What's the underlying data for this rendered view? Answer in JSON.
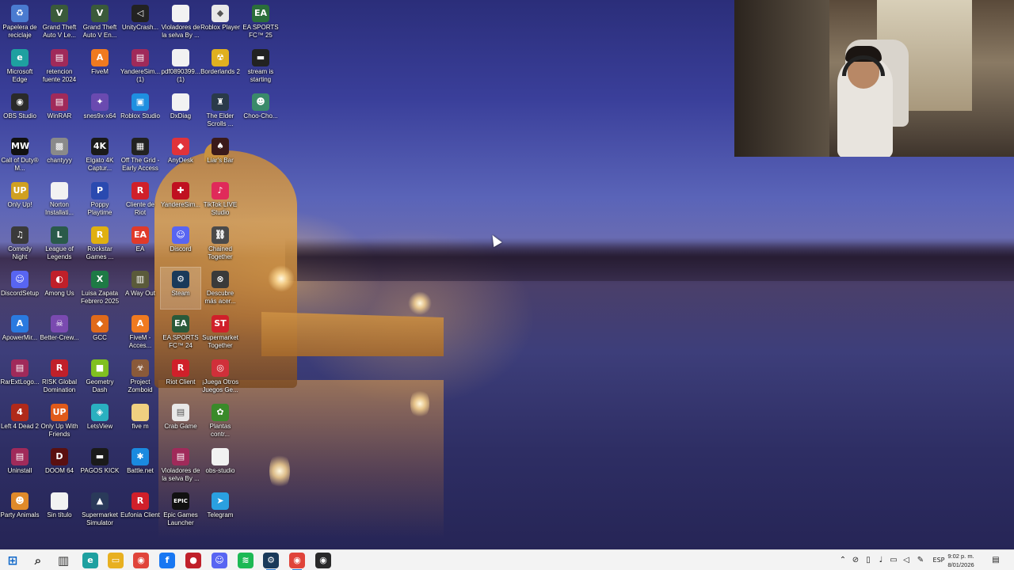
{
  "desktop": {
    "icons": [
      {
        "id": "i0",
        "label": "Papelera de reciclaje",
        "icon": "recycle-bin-icon",
        "color": "#4a7bd0",
        "glyph": "♻"
      },
      {
        "id": "i1",
        "label": "Grand Theft Auto V Le...",
        "icon": "gta-v-icon",
        "color": "#3a5a3a",
        "glyph": "V"
      },
      {
        "id": "i2",
        "label": "Grand Theft Auto V En...",
        "icon": "gta-v-icon",
        "color": "#3a5a3a",
        "glyph": "V"
      },
      {
        "id": "i3",
        "label": "UnityCrash...",
        "icon": "unity-icon",
        "color": "#222222",
        "glyph": "◁"
      },
      {
        "id": "i4",
        "label": "Violadores de la selva By ...",
        "icon": "file-icon",
        "color": "#f2f2f2",
        "glyph": ""
      },
      {
        "id": "i5",
        "label": "Roblox Player",
        "icon": "roblox-icon",
        "color": "#e8e8e8",
        "glyph": "◆"
      },
      {
        "id": "i6",
        "label": "EA SPORTS FC™ 25",
        "icon": "ea-fc-icon",
        "color": "#2b6e3a",
        "glyph": "EA"
      },
      {
        "id": "i7",
        "label": "Microsoft Edge",
        "icon": "edge-icon",
        "color": "#1ea0a0",
        "glyph": "e"
      },
      {
        "id": "i8",
        "label": "retencion fuente 2024",
        "icon": "winrar-archive-icon",
        "color": "#a02a5a",
        "glyph": "▤"
      },
      {
        "id": "i9",
        "label": "FiveM",
        "icon": "fivem-icon",
        "color": "#f07a20",
        "glyph": "A"
      },
      {
        "id": "i10",
        "label": "YandereSim... (1)",
        "icon": "winrar-archive-icon",
        "color": "#a02a5a",
        "glyph": "▤"
      },
      {
        "id": "i11",
        "label": "pdf0890399... (1)",
        "icon": "file-icon",
        "color": "#f2f2f2",
        "glyph": ""
      },
      {
        "id": "i12",
        "label": "Borderlands 2",
        "icon": "borderlands-icon",
        "color": "#e0b020",
        "glyph": "☢"
      },
      {
        "id": "i13",
        "label": "stream is starting",
        "icon": "image-file-icon",
        "color": "#222222",
        "glyph": "▬"
      },
      {
        "id": "i14",
        "label": "OBS Studio",
        "icon": "obs-icon",
        "color": "#2a2a2a",
        "glyph": "◉"
      },
      {
        "id": "i15",
        "label": "WinRAR",
        "icon": "winrar-icon",
        "color": "#a02a5a",
        "glyph": "▤"
      },
      {
        "id": "i16",
        "label": "snes9x-x64",
        "icon": "snes-icon",
        "color": "#6a4ab0",
        "glyph": "✦"
      },
      {
        "id": "i17",
        "label": "Roblox Studio",
        "icon": "roblox-studio-icon",
        "color": "#1e8fe0",
        "glyph": "▣"
      },
      {
        "id": "i18",
        "label": "DxDiag",
        "icon": "file-icon",
        "color": "#f2f2f2",
        "glyph": ""
      },
      {
        "id": "i19",
        "label": "The Elder Scrolls ...",
        "icon": "elder-scrolls-icon",
        "color": "#2a3a4a",
        "glyph": "♜"
      },
      {
        "id": "i20",
        "label": "Choo-Cho...",
        "icon": "choo-choo-icon",
        "color": "#3a8a6a",
        "glyph": "☻"
      },
      {
        "id": "i21",
        "label": "Call of Duty® M...",
        "icon": "call-of-duty-icon",
        "color": "#111111",
        "glyph": "MW"
      },
      {
        "id": "i22",
        "label": "chantyyy",
        "icon": "image-file-icon",
        "color": "#8a8a8a",
        "glyph": "▩"
      },
      {
        "id": "i23",
        "label": "Elgato 4K Captur...",
        "icon": "elgato-icon",
        "color": "#1a1a1a",
        "glyph": "4K"
      },
      {
        "id": "i24",
        "label": "Off The Grid - Early Access",
        "icon": "off-the-grid-icon",
        "color": "#222222",
        "glyph": "▦"
      },
      {
        "id": "i25",
        "label": "AnyDesk",
        "icon": "anydesk-icon",
        "color": "#e0333a",
        "glyph": "◆"
      },
      {
        "id": "i26",
        "label": "Liar's Bar",
        "icon": "liars-bar-icon",
        "color": "#3a1a1a",
        "glyph": "♠"
      },
      {
        "id": "i27",
        "label": "Only Up!",
        "icon": "only-up-icon",
        "color": "#d0a020",
        "glyph": "UP"
      },
      {
        "id": "i28",
        "label": "Norton Installati...",
        "icon": "file-icon",
        "color": "#f2f2f2",
        "glyph": ""
      },
      {
        "id": "i29",
        "label": "Poppy Playtime",
        "icon": "poppy-playtime-icon",
        "color": "#2a4ab0",
        "glyph": "P"
      },
      {
        "id": "i30",
        "label": "Cliente de Riot",
        "icon": "riot-icon",
        "color": "#d0202a",
        "glyph": "R"
      },
      {
        "id": "i31",
        "label": "YandereSim...",
        "icon": "yandere-icon",
        "color": "#c01020",
        "glyph": "✚"
      },
      {
        "id": "i32",
        "label": "TikTok LIVE Studio",
        "icon": "tiktok-live-icon",
        "color": "#e02a5a",
        "glyph": "♪"
      },
      {
        "id": "i33",
        "label": "Comedy Night",
        "icon": "comedy-night-icon",
        "color": "#3a3a3a",
        "glyph": "♫"
      },
      {
        "id": "i34",
        "label": "League of Legends",
        "icon": "league-icon",
        "color": "#2a5a4a",
        "glyph": "L"
      },
      {
        "id": "i35",
        "label": "Rockstar Games ...",
        "icon": "rockstar-icon",
        "color": "#e0b010",
        "glyph": "R"
      },
      {
        "id": "i36",
        "label": "EA",
        "icon": "ea-icon",
        "color": "#e03a2a",
        "glyph": "EA"
      },
      {
        "id": "i37",
        "label": "Discord",
        "icon": "discord-icon",
        "color": "#5865f2",
        "glyph": "☺"
      },
      {
        "id": "i38",
        "label": "Chained Together",
        "icon": "chained-together-icon",
        "color": "#4a4a4a",
        "glyph": "⛓"
      },
      {
        "id": "i39",
        "label": "DiscordSetup",
        "icon": "discord-icon",
        "color": "#5865f2",
        "glyph": "☺"
      },
      {
        "id": "i40",
        "label": "Among Us",
        "icon": "among-us-icon",
        "color": "#c0202a",
        "glyph": "◐"
      },
      {
        "id": "i41",
        "label": "Luisa Zapata Febrero 2025",
        "icon": "excel-icon",
        "color": "#1e7a45",
        "glyph": "X"
      },
      {
        "id": "i42",
        "label": "A Way Out",
        "icon": "a-way-out-icon",
        "color": "#5a5a3a",
        "glyph": "▥"
      },
      {
        "id": "i43",
        "label": "Steam",
        "icon": "steam-icon",
        "color": "#1a3a5a",
        "glyph": "⚙"
      },
      {
        "id": "i44",
        "label": "Descubre más acer...",
        "icon": "settings-icon",
        "color": "#3a3a3a",
        "glyph": "⊗"
      },
      {
        "id": "i45",
        "label": "ApowerMir...",
        "icon": "apowermirror-icon",
        "color": "#2a7ae0",
        "glyph": "A"
      },
      {
        "id": "i46",
        "label": "Better-Crew...",
        "icon": "better-crew-icon",
        "color": "#7a4ab0",
        "glyph": "☠"
      },
      {
        "id": "i47",
        "label": "GCC",
        "icon": "gcc-icon",
        "color": "#e06a1a",
        "glyph": "◆"
      },
      {
        "id": "i48",
        "label": "FiveM - Acces...",
        "icon": "fivem-icon",
        "color": "#f07a20",
        "glyph": "A"
      },
      {
        "id": "i49",
        "label": "EA SPORTS FC™ 24",
        "icon": "ea-fc-icon",
        "color": "#2a5a3a",
        "glyph": "EA"
      },
      {
        "id": "i50",
        "label": "Supermarket Together",
        "icon": "supermarket-together-icon",
        "color": "#d0202a",
        "glyph": "ST"
      },
      {
        "id": "i51",
        "label": "RarExtLogo...",
        "icon": "winrar-archive-icon",
        "color": "#a02a5a",
        "glyph": "▤"
      },
      {
        "id": "i52",
        "label": "RISK Global Domination",
        "icon": "risk-icon",
        "color": "#c0202a",
        "glyph": "R"
      },
      {
        "id": "i53",
        "label": "Geometry Dash",
        "icon": "geometry-dash-icon",
        "color": "#80c020",
        "glyph": "■"
      },
      {
        "id": "i54",
        "label": "Project Zomboid",
        "icon": "project-zomboid-icon",
        "color": "#8a5a3a",
        "glyph": "☣"
      },
      {
        "id": "i55",
        "label": "Riot Client",
        "icon": "riot-icon",
        "color": "#d0202a",
        "glyph": "R"
      },
      {
        "id": "i56",
        "label": "¡Juega Otros Juegos Ge...",
        "icon": "game-icon",
        "color": "#d0303a",
        "glyph": "◎"
      },
      {
        "id": "i57",
        "label": "Left 4 Dead 2",
        "icon": "left4dead-icon",
        "color": "#b02a1a",
        "glyph": "4"
      },
      {
        "id": "i58",
        "label": "Only Up With Friends",
        "icon": "only-up-icon",
        "color": "#e05a1a",
        "glyph": "UP"
      },
      {
        "id": "i59",
        "label": "LetsView",
        "icon": "letsview-icon",
        "color": "#2ab0c0",
        "glyph": "◈"
      },
      {
        "id": "i60",
        "label": "five m",
        "icon": "file-icon",
        "color": "#f0d080",
        "glyph": ""
      },
      {
        "id": "i61",
        "label": "Crab Game",
        "icon": "crab-game-icon",
        "color": "#e8e8e8",
        "glyph": "▤"
      },
      {
        "id": "i62",
        "label": "Plantas contr...",
        "icon": "plants-vs-zombies-icon",
        "color": "#3a8a2a",
        "glyph": "✿"
      },
      {
        "id": "i63",
        "label": "Uninstall",
        "icon": "winrar-archive-icon",
        "color": "#a02a5a",
        "glyph": "▤"
      },
      {
        "id": "i64",
        "label": "DOOM 64",
        "icon": "doom-icon",
        "color": "#5a1010",
        "glyph": "D"
      },
      {
        "id": "i65",
        "label": "PAGOS KICK",
        "icon": "image-file-icon",
        "color": "#1a1a1a",
        "glyph": "▬"
      },
      {
        "id": "i66",
        "label": "Battle.net",
        "icon": "battlenet-icon",
        "color": "#1a8ae0",
        "glyph": "✱"
      },
      {
        "id": "i67",
        "label": "Violadores de la selva By ...",
        "icon": "winrar-archive-icon",
        "color": "#a02a5a",
        "glyph": "▤"
      },
      {
        "id": "i68",
        "label": "obs-studio",
        "icon": "file-icon",
        "color": "#f2f2f2",
        "glyph": ""
      },
      {
        "id": "i69",
        "label": "Party Animals",
        "icon": "party-animals-icon",
        "color": "#e08a2a",
        "glyph": "☻"
      },
      {
        "id": "i70",
        "label": "Sin título",
        "icon": "file-icon",
        "color": "#f2f2f2",
        "glyph": ""
      },
      {
        "id": "i71",
        "label": "Supermarket Simulator",
        "icon": "supermarket-simulator-icon",
        "color": "#2a3a5a",
        "glyph": "▲"
      },
      {
        "id": "i72",
        "label": "Eufonia Client",
        "icon": "eufonia-icon",
        "color": "#d0202a",
        "glyph": "R"
      },
      {
        "id": "i73",
        "label": "Epic Games Launcher",
        "icon": "epic-games-icon",
        "color": "#111111",
        "glyph": "EPIC"
      },
      {
        "id": "i74",
        "label": "Telegram",
        "icon": "telegram-icon",
        "color": "#2aa0e0",
        "glyph": "➤"
      }
    ]
  },
  "taskbar": {
    "pinned": [
      {
        "icon": "windows-start-icon",
        "color": "#0a64c8",
        "glyph": "⊞"
      },
      {
        "icon": "search-icon",
        "color": "#333333",
        "glyph": "⌕"
      },
      {
        "icon": "task-view-icon",
        "color": "#333333",
        "glyph": "▥"
      },
      {
        "icon": "edge-icon",
        "color": "#1ea0a0",
        "glyph": "e"
      },
      {
        "icon": "file-explorer-icon",
        "color": "#e8b020",
        "glyph": "▭"
      },
      {
        "icon": "chrome-icon",
        "color": "#e0443a",
        "glyph": "◉"
      },
      {
        "icon": "facebook-icon",
        "color": "#1877f2",
        "glyph": "f"
      },
      {
        "icon": "record-app-icon",
        "color": "#c0202a",
        "glyph": "●"
      },
      {
        "icon": "discord-icon",
        "color": "#5865f2",
        "glyph": "☺"
      },
      {
        "icon": "spotify-icon",
        "color": "#1db954",
        "glyph": "≋"
      },
      {
        "icon": "steam-icon",
        "color": "#1a3a5a",
        "glyph": "⚙"
      },
      {
        "icon": "chrome-icon",
        "color": "#e0443a",
        "glyph": "◉"
      },
      {
        "icon": "obs-icon",
        "color": "#2a2a2a",
        "glyph": "◉"
      }
    ],
    "tray_icons": [
      "chevron-up-icon",
      "network-icon",
      "usb-icon",
      "microphone-icon",
      "display-icon",
      "speaker-icon",
      "pen-icon"
    ],
    "language": "ESP",
    "time": "9:02 p. m.",
    "date": "8/01/2026",
    "notification_icon": "notification-icon"
  }
}
